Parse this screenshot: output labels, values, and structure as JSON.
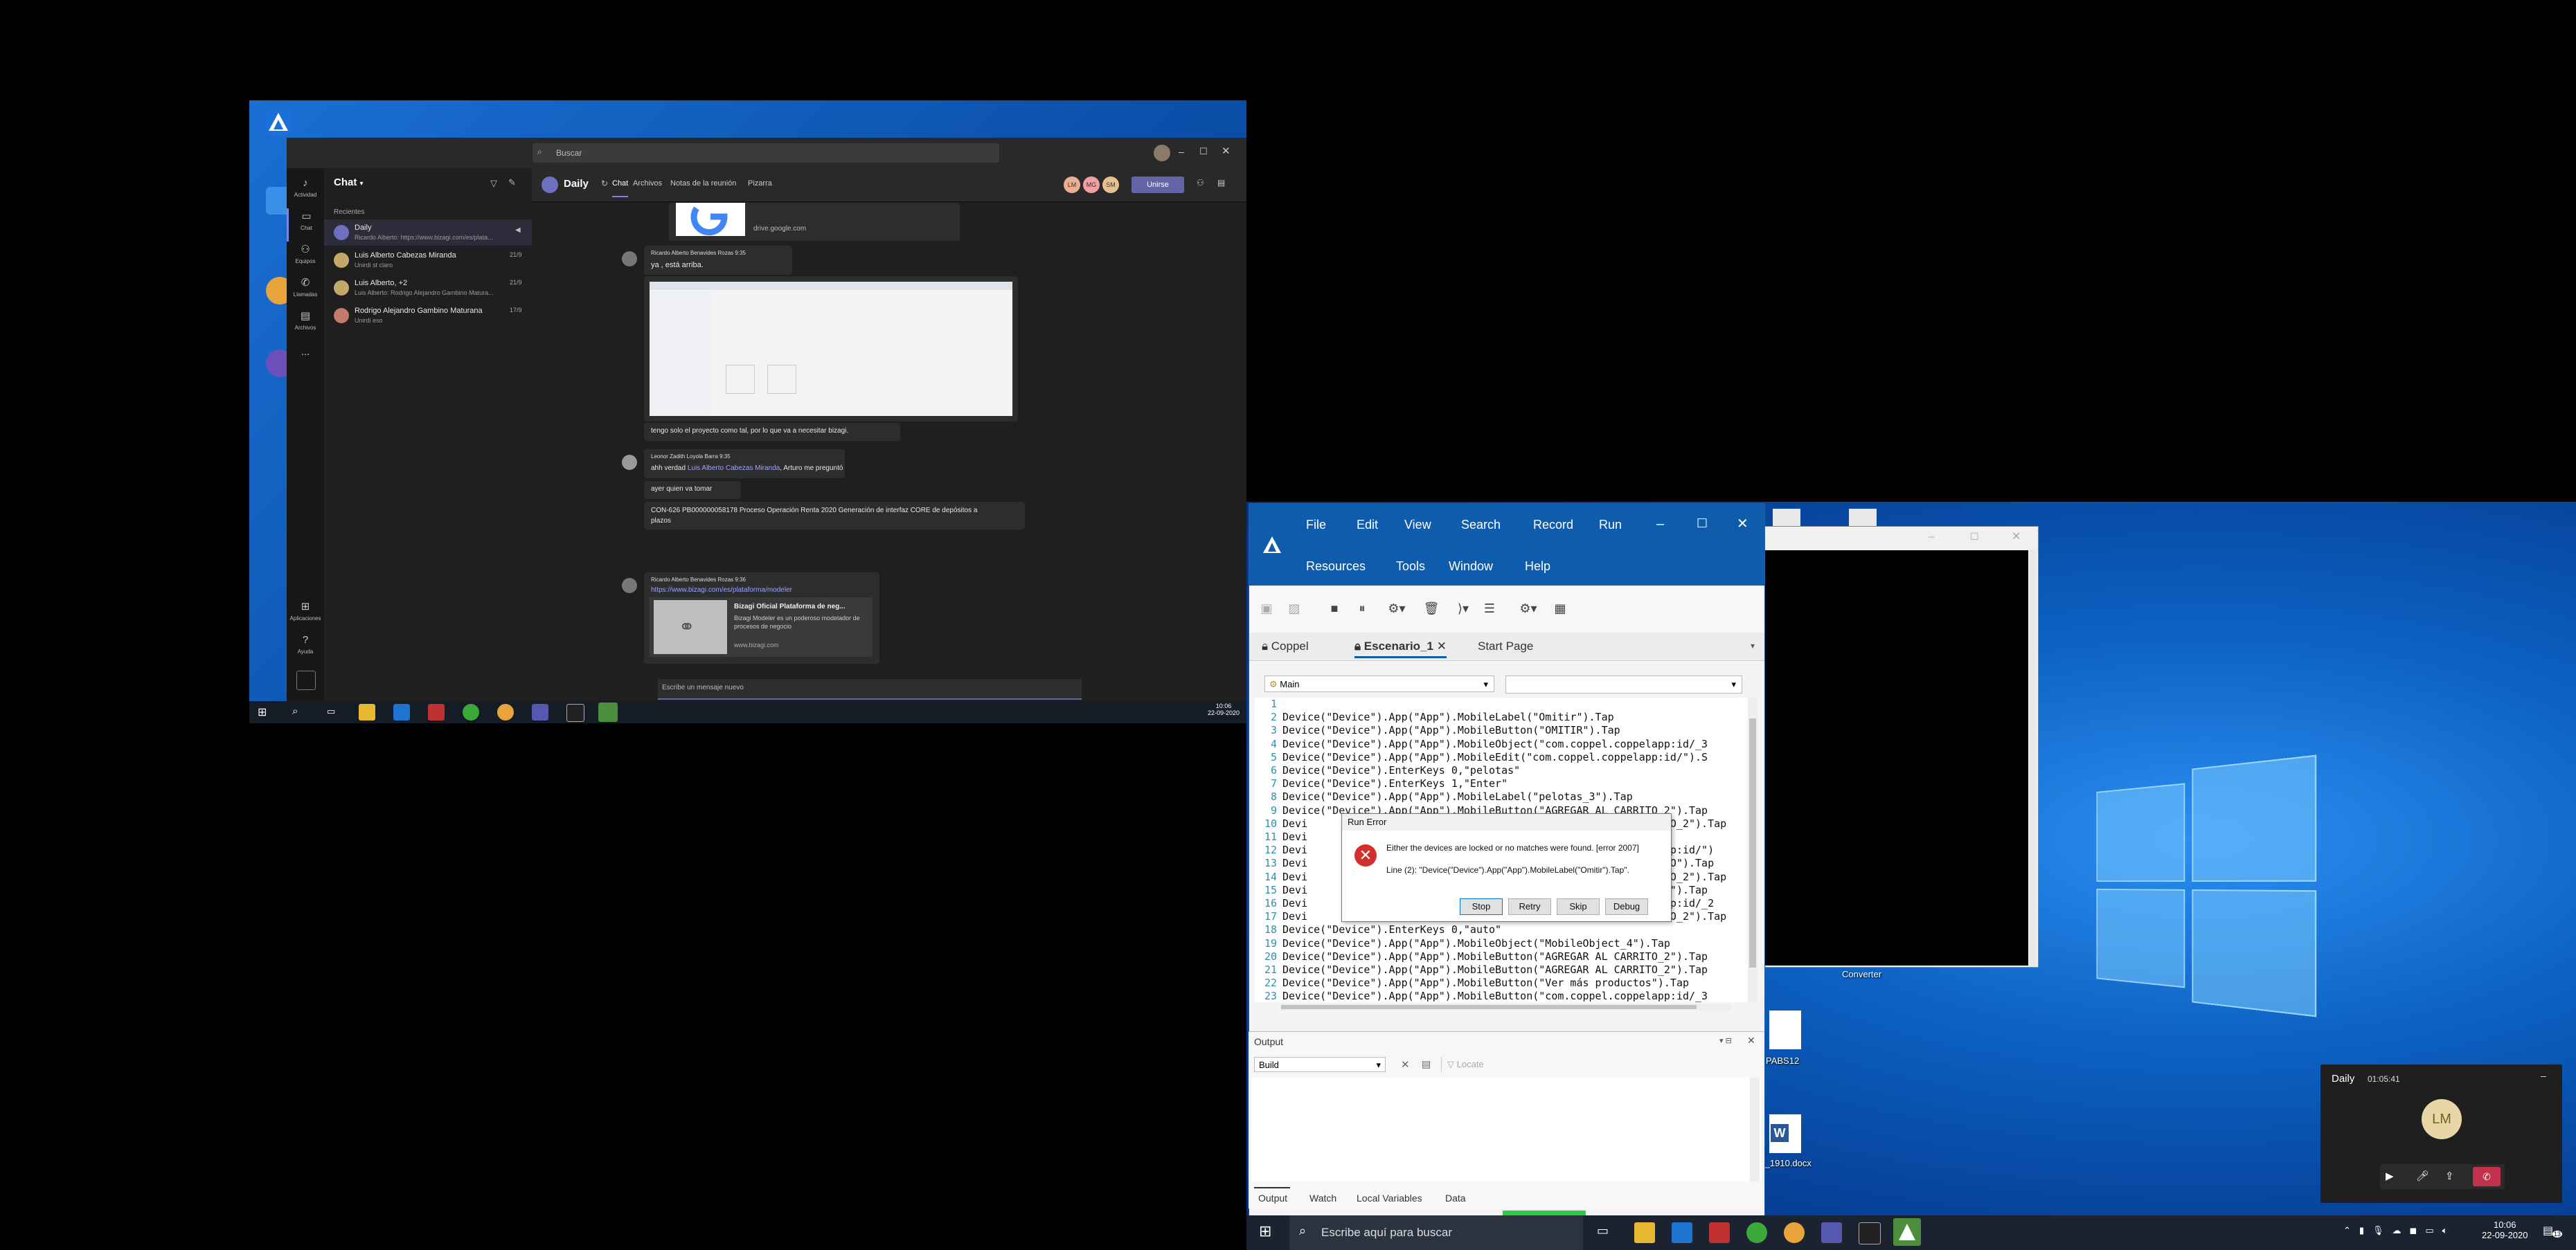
{
  "teams": {
    "search_placeholder": "Buscar",
    "rail": [
      {
        "label": "Actividad",
        "icon": "bell-icon"
      },
      {
        "label": "Chat",
        "icon": "chat-icon"
      },
      {
        "label": "Equipos",
        "icon": "teams-icon"
      },
      {
        "label": "Llamadas",
        "icon": "phone-icon"
      },
      {
        "label": "Archivos",
        "icon": "files-icon"
      },
      {
        "label": "...",
        "icon": "more-icon"
      },
      {
        "label": "Aplicaciones",
        "icon": "apps-icon"
      },
      {
        "label": "Ayuda",
        "icon": "help-icon"
      }
    ],
    "chatlist_title": "Chat",
    "recent_label": "Recientes",
    "chats": [
      {
        "name": "Daily",
        "sub": "Ricardo Alberto: https://www.bizagi.com/es/plata...",
        "date": ""
      },
      {
        "name": "Luis Alberto Cabezas Miranda",
        "sub": "Unirdi st claro",
        "date": "21/9"
      },
      {
        "name": "Luis Alberto, +2",
        "sub": "Luis Alberto: Rodrigo Alejandro Gambino Matura...",
        "date": "21/9"
      },
      {
        "name": "Rodrigo Alejandro Gambino Maturana",
        "sub": "Unirdi eso",
        "date": "17/9"
      }
    ],
    "conv_title": "Daily",
    "conv_tabs": [
      "Chat",
      "Archivos",
      "Notas de la reunión",
      "Pizarra"
    ],
    "participants": [
      "LM",
      "MG",
      "SM"
    ],
    "join_button": "Unirse",
    "messages": {
      "drive_link": "drive.google.com",
      "m1_author": "Ricardo Alberto Benavides Rozas   9:35",
      "m1_text1": "ya , está arriba.",
      "m1_text2": "tengo solo el proyecto como tal, por lo que va a necesitar bizagi.",
      "m2_author": "Leonor Zadith Loyola Barra   9:35",
      "m2_text1_a": "ahh verdad ",
      "m2_text1_mention": "Luis Alberto Cabezas Miranda",
      "m2_text1_b": ", Arturo me preguntó",
      "m2_text2": "ayer quien va tomar",
      "m2_text3": "CON-626 PB000000058178 Proceso Operación Renta 2020 Generación de interfaz CORE de depósitos a plazos",
      "m3_author": "Ricardo Alberto Benavides Rozas   9:36",
      "m3_link": "https://www.bizagi.com/es/plataforma/modeler",
      "m3_card_title": "Bizagi Oficial Plataforma de neg...",
      "m3_card_desc": "Bizagi Modeler es un poderoso modelador de procesos de negocio",
      "m3_card_site": "www.bizagi.com"
    },
    "compose_placeholder": "Escribe un mensaje nuevo"
  },
  "left_taskbar": {
    "time": "10:06",
    "date": "22-09-2020"
  },
  "ide": {
    "menu_row1": [
      "File",
      "Edit",
      "View",
      "Search",
      "Record",
      "Run"
    ],
    "menu_row2": [
      "Resources",
      "Tools",
      "Window",
      "Help"
    ],
    "tabs": [
      "Coppel",
      "Escenario_1",
      "Start Page"
    ],
    "scope_select": "Main",
    "code_lines": [
      {
        "n": "1",
        "text": ""
      },
      {
        "n": "2",
        "text": "Device(\"Device\").App(\"App\").MobileLabel(\"Omitir\").Tap"
      },
      {
        "n": "3",
        "text": "Device(\"Device\").App(\"App\").MobileButton(\"OMITIR\").Tap"
      },
      {
        "n": "4",
        "text": "Device(\"Device\").App(\"App\").MobileObject(\"com.coppel.coppelapp:id/_3"
      },
      {
        "n": "5",
        "text": "Device(\"Device\").App(\"App\").MobileEdit(\"com.coppel.coppelapp:id/\").S"
      },
      {
        "n": "6",
        "text": "Device(\"Device\").EnterKeys 0,\"pelotas\""
      },
      {
        "n": "7",
        "text": "Device(\"Device\").EnterKeys 1,\"Enter\""
      },
      {
        "n": "8",
        "text": "Device(\"Device\").App(\"App\").MobileLabel(\"pelotas_3\").Tap"
      },
      {
        "n": "9",
        "text": "Device(\"Device\").App(\"App\").MobileButton(\"AGREGAR AL CARRITO_2\").Tap"
      },
      {
        "n": "10",
        "text": "Devi                                                         TO_2\").Tap"
      },
      {
        "n": "11",
        "text": "Devi"
      },
      {
        "n": "12",
        "text": "Devi                                                         pp:id/\")"
      },
      {
        "n": "13",
        "text": "Devi                                                         TO\").Tap"
      },
      {
        "n": "14",
        "text": "Devi                                                         TO_2\").Tap"
      },
      {
        "n": "15",
        "text": "Devi                                                         s\").Tap"
      },
      {
        "n": "16",
        "text": "Devi                                                         pp:id/_2"
      },
      {
        "n": "17",
        "text": "Devi                                                         TO_2\").Tap"
      },
      {
        "n": "18",
        "text": "Device(\"Device\").EnterKeys 0,\"auto\""
      },
      {
        "n": "19",
        "text": "Device(\"Device\").App(\"App\").MobileObject(\"MobileObject_4\").Tap"
      },
      {
        "n": "20",
        "text": "Device(\"Device\").App(\"App\").MobileButton(\"AGREGAR AL CARRITO_2\").Tap"
      },
      {
        "n": "21",
        "text": "Device(\"Device\").App(\"App\").MobileButton(\"AGREGAR AL CARRITO_2\").Tap"
      },
      {
        "n": "22",
        "text": "Device(\"Device\").App(\"App\").MobileButton(\"Ver más productos\").Tap"
      },
      {
        "n": "23",
        "text": "Device(\"Device\").App(\"App\").MobileButton(\"com.coppel.coppelapp:id/_3"
      }
    ],
    "error_dialog": {
      "title": "Run Error",
      "message": "Either the devices are locked or no matches were found. [error 2007]",
      "detail": "Line (2): \"Device(\"Device\").App(\"App\").MobileLabel(\"Omitir\").Tap\".",
      "buttons": [
        "Stop",
        "Retry",
        "Skip",
        "Debug"
      ]
    },
    "output": {
      "title": "Output",
      "select": "Build",
      "locate_label": "Locate",
      "bottom_tabs": [
        "Output",
        "Watch",
        "Local Variables",
        "Data"
      ]
    }
  },
  "desktop_icons": [
    "Converter",
    "PABS12",
    "S_1910.docx"
  ],
  "taskbar": {
    "search_placeholder": "Escribe aquí para buscar",
    "time": "10:06",
    "date": "22-09-2020",
    "notification_count": "13"
  },
  "call_card": {
    "title": "Daily",
    "duration": "01:05:41",
    "initials": "LM",
    "minimize": "–"
  }
}
